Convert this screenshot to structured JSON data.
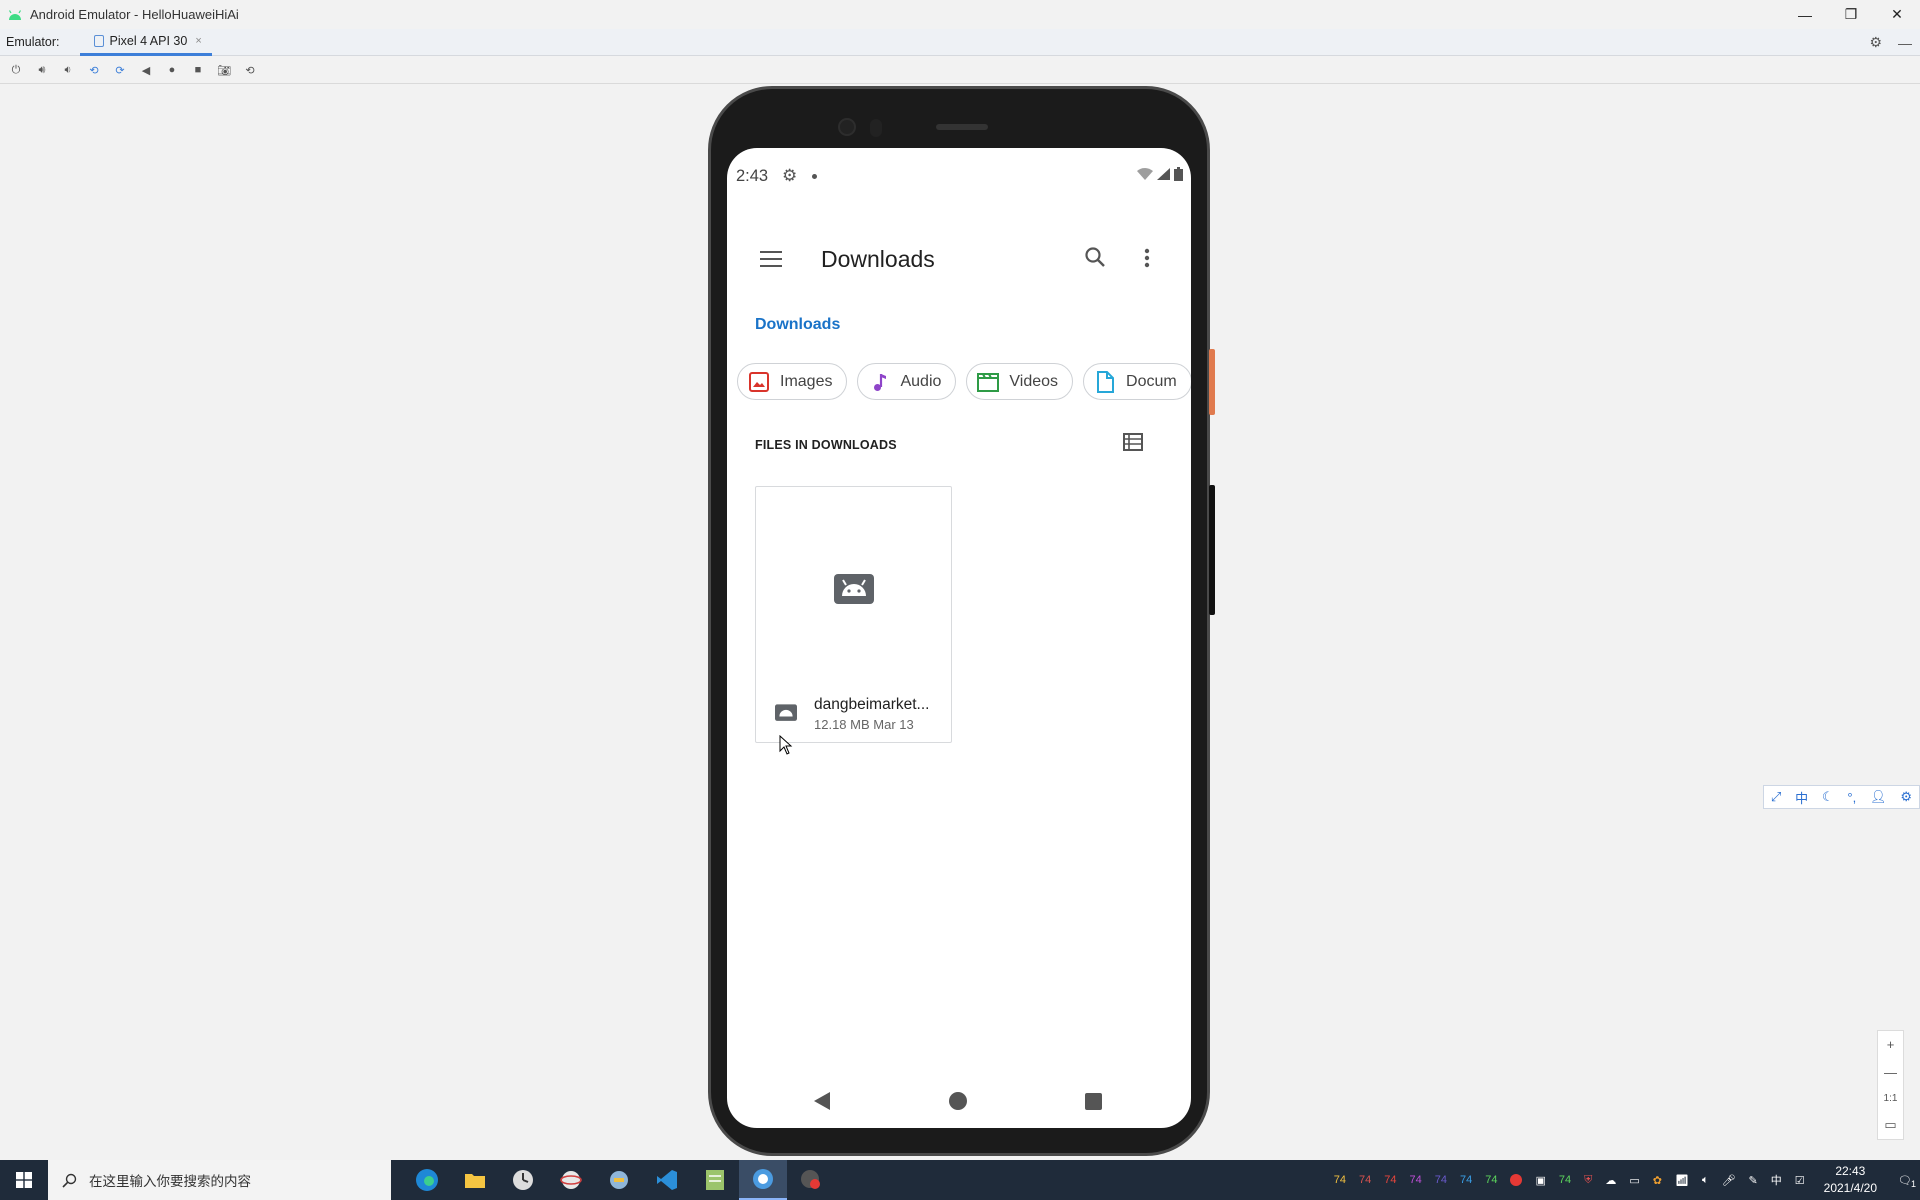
{
  "window": {
    "title": "Android Emulator - HelloHuaweiHiAi",
    "minimize": "—",
    "restore": "❐",
    "close": "✕"
  },
  "tabbar": {
    "label": "Emulator:",
    "tab_label": "Pixel 4 API 30",
    "tab_close": "×"
  },
  "phone": {
    "status": {
      "time": "2:43"
    },
    "appbar": {
      "title": "Downloads"
    },
    "breadcrumb": "Downloads",
    "chips": [
      {
        "label": "Images",
        "icon": "image-icon",
        "color": "#d9342b"
      },
      {
        "label": "Audio",
        "icon": "music-note-icon",
        "color": "#8e44c9"
      },
      {
        "label": "Videos",
        "icon": "video-clapper-icon",
        "color": "#2e9b46"
      },
      {
        "label": "Docum",
        "icon": "document-icon",
        "color": "#26a7d8"
      }
    ],
    "section_header": "FILES IN DOWNLOADS",
    "file": {
      "name": "dangbeimarket...",
      "size": "12.18 MB",
      "date": "Mar 13"
    }
  },
  "ime": {
    "lang": "中"
  },
  "zoom": {
    "plus": "+",
    "minus": "—",
    "ratio": "1:1"
  },
  "taskbar": {
    "search_placeholder": "在这里输入你要搜索的内容",
    "tray_numbers": [
      "74",
      "74",
      "74",
      "74",
      "74",
      "74",
      "74",
      "74"
    ],
    "ime_lang": "中",
    "time": "22:43",
    "date": "2021/4/20",
    "notif_count": "1"
  },
  "colors": {
    "accent_blue": "#1a73c8",
    "taskbar_bg": "#1f2b3a",
    "android_green": "#3ddc84"
  }
}
